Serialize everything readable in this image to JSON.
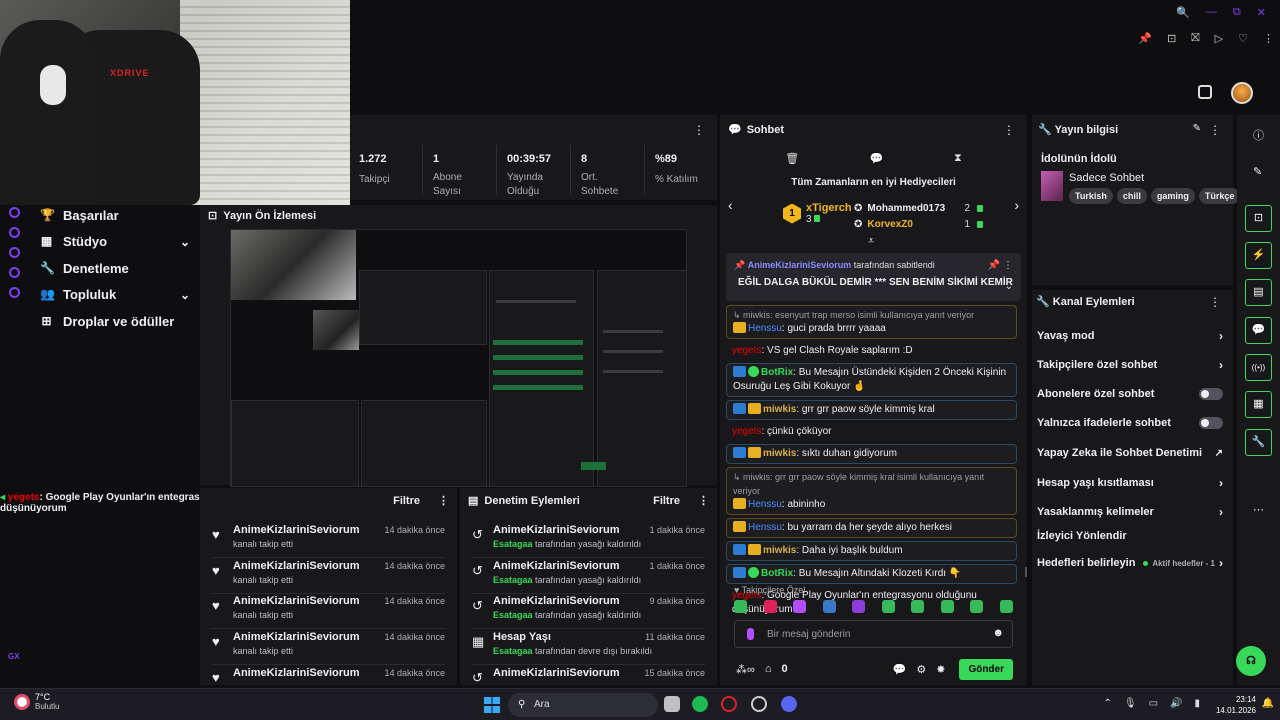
{
  "webcam": {
    "brand": "XDRIVE"
  },
  "window_controls": [
    "🔍",
    "—",
    "⧉",
    "✕"
  ],
  "toolbar_icons": [
    "📌",
    "⊡",
    "⛝",
    "▷",
    "♡",
    "⋮"
  ],
  "stats": {
    "menu": "⋮",
    "items": [
      {
        "value": "1.272",
        "label": "Takipçi"
      },
      {
        "value": "1",
        "label": "Abone Sayısı"
      },
      {
        "value": "00:39:57",
        "label": "Yayında Olduğu"
      },
      {
        "value": "8",
        "label": "Ort. Sohbete"
      },
      {
        "value": "%89",
        "label": "% Katılım"
      }
    ]
  },
  "sidebar": {
    "items": [
      {
        "label": "Başarılar",
        "icon": "trophy-icon",
        "glyph": "🏆"
      },
      {
        "label": "Stüdyo",
        "icon": "studio-icon",
        "glyph": "▦",
        "chevron": "⌄"
      },
      {
        "label": "Denetleme",
        "icon": "wrench-icon",
        "glyph": "🔧"
      },
      {
        "label": "Topluluk",
        "icon": "community-icon",
        "glyph": "👥",
        "chevron": "⌄"
      },
      {
        "label": "Droplar ve ödüller",
        "icon": "drops-icon",
        "glyph": "⊞"
      }
    ]
  },
  "preview": {
    "title": "Yayın Ön İzlemesi"
  },
  "ticker": {
    "user": "yegets",
    "text": ": Google Play Oyunlar'ın entegrasyonu olduğunu düşünüyorum"
  },
  "follows": {
    "filter": "Filtre",
    "menu": "⋮",
    "rows": [
      {
        "name": "AnimeKizlariniSeviorum",
        "sub": "kanalı takip etti",
        "time": "14 dakika önce"
      },
      {
        "name": "AnimeKizlariniSeviorum",
        "sub": "kanalı takip etti",
        "time": "14 dakika önce"
      },
      {
        "name": "AnimeKizlariniSeviorum",
        "sub": "kanalı takip etti",
        "time": "14 dakika önce"
      },
      {
        "name": "AnimeKizlariniSeviorum",
        "sub": "kanalı takip etti",
        "time": "14 dakika önce"
      },
      {
        "name": "AnimeKizlariniSeviorum",
        "sub": "",
        "time": "14 dakika önce"
      }
    ]
  },
  "mod_actions": {
    "title": "Denetim Eylemleri",
    "filter": "Filtre",
    "menu": "⋮",
    "rows": [
      {
        "name": "AnimeKizlariniSeviorum",
        "actor": "Esatagaa",
        "sub": " tarafından yasağı kaldırıldı",
        "time": "1 dakika önce",
        "icon": "↺"
      },
      {
        "name": "AnimeKizlariniSeviorum",
        "actor": "Esatagaa",
        "sub": " tarafından yasağı kaldırıldı",
        "time": "1 dakika önce",
        "icon": "↺"
      },
      {
        "name": "AnimeKizlariniSeviorum",
        "actor": "Esatagaa",
        "sub": " tarafından yasağı kaldırıldı",
        "time": "9 dakika önce",
        "icon": "↺"
      },
      {
        "name": "Hesap Yaşı",
        "actor": "Esatagaa",
        "sub": " tarafından devre dışı bırakıldı",
        "time": "11 dakika önce",
        "icon": "▦"
      },
      {
        "name": "AnimeKizlariniSeviorum",
        "actor": "",
        "sub": "",
        "time": "15 dakika önce",
        "icon": "↺"
      }
    ]
  },
  "chat": {
    "title": "Sohbet",
    "menu": "⋮",
    "icons": [
      "🗑",
      "💬",
      "⧗"
    ],
    "leaderboard_title": "Tüm Zamanların en iyi Hediyecileri",
    "top1": {
      "rank": "1",
      "name": "xTigerch",
      "count": "3"
    },
    "top2": {
      "name": "Mohammed0173",
      "count": "2"
    },
    "top3": {
      "name": "KorvexZ0",
      "count": "1"
    },
    "pinned_by": "AnimeKizlariniSeviorum",
    "pinned_suffix": " tarafından sabitlendi",
    "pinned_text": "EĞİL DALGA BÜKÜL DEMİR *** SEN BENİM SİKİMİ KEMİR",
    "messages": [
      {
        "reply": "↳ miwkis: esenyurt trap merso isimli kullanıcıya yanıt veriyor",
        "user": "Henssu",
        "cls": "u-blue",
        "badges": [
          "crown"
        ],
        "text": ": guci prada brrrr yaaaa",
        "style": "hl"
      },
      {
        "user": "yegets",
        "cls": "u-red",
        "badges": [],
        "text": ": VS gel Clash Royale saplarım :D",
        "style": ""
      },
      {
        "user": "BotRix",
        "cls": "u-grn",
        "badges": [
          "mod",
          "vip"
        ],
        "text": ": Bu Mesajın Üstündeki Kişiden 2 Önceki Kişinin Osuruğu Leş Gibi Kokuyor 🤞",
        "style": "bluehl"
      },
      {
        "user": "miwkis",
        "cls": "u-gold",
        "badges": [
          "mod",
          "crown"
        ],
        "text": ": grr grr paow söyle kimmiş kral",
        "style": "bluehl"
      },
      {
        "user": "yegets",
        "cls": "u-red",
        "badges": [],
        "text": ": çünkü çöküyor",
        "style": ""
      },
      {
        "user": "miwkis",
        "cls": "u-gold",
        "badges": [
          "mod",
          "crown"
        ],
        "text": ": sıktı duhan gidiyorum",
        "style": "bluehl"
      },
      {
        "reply": "↳ miwkis: grr grr paow söyle kimmiş kral isimli kullanıcıya yanıt veriyor",
        "user": "Henssu",
        "cls": "u-blue",
        "badges": [
          "crown"
        ],
        "text": ": abininho",
        "style": "hl"
      },
      {
        "user": "Henssu",
        "cls": "u-blue",
        "badges": [
          "crown"
        ],
        "text": ": bu yarram da her şeyde alıyo herkesi",
        "style": "hl"
      },
      {
        "user": "miwkis",
        "cls": "u-gold",
        "badges": [
          "mod",
          "crown"
        ],
        "text": ": Daha iyi başlık buldum",
        "style": "bluehl"
      },
      {
        "user": "BotRix",
        "cls": "u-grn",
        "badges": [
          "mod",
          "vip"
        ],
        "text": ": Bu Mesajın Altındaki Klozeti Kırdı 👇",
        "style": "bluehl"
      },
      {
        "user": "yegets",
        "cls": "u-red",
        "badges": [],
        "text": ": Google Play Oyunlar'ın entegrasyonu olduğunu düşünüyorum",
        "style": ""
      }
    ],
    "follower_label": "♥ Takipçilere Özel",
    "input_placeholder": "Bir mesaj gönderin",
    "points": "0",
    "send_label": "Gönder",
    "emoji": "☻"
  },
  "info": {
    "title": "Yayın bilgisi",
    "stream_title": "İdolünün İdolü",
    "category": "Sadece Sohbet",
    "tags": [
      "Turkish",
      "chill",
      "gaming",
      "Türkçe"
    ]
  },
  "actions": {
    "title": "Kanal Eylemleri",
    "items": [
      {
        "label": "Yavaş mod",
        "kind": "chevron"
      },
      {
        "label": "Takipçilere özel sohbet",
        "kind": "chevron"
      },
      {
        "label": "Abonelere özel sohbet",
        "kind": "toggle"
      },
      {
        "label": "Yalnızca ifadelerle sohbet",
        "kind": "toggle"
      },
      {
        "label": "Yapay Zeka ile Sohbet Denetimi",
        "kind": "external"
      },
      {
        "label": "Hesap yaşı kısıtlaması",
        "kind": "chevron"
      },
      {
        "label": "Yasaklanmış kelimeler",
        "kind": "chevron"
      },
      {
        "label": "İzleyici Yönlendir",
        "kind": "none"
      },
      {
        "label": "Hedefleri belirleyin",
        "kind": "aktif",
        "aktif": "Aktif hedefler - 1"
      }
    ]
  },
  "rail_icons": [
    "ⓘ",
    "✎",
    "⊡",
    "⚡",
    "▤",
    "💬",
    "((•))",
    "▦",
    "🔧",
    "⋯"
  ],
  "taskbar": {
    "temp": "7°C",
    "weather": "Bulutlu",
    "search": "Ara",
    "time": "23:14",
    "date": "14.01.2026",
    "gx": "GX"
  }
}
